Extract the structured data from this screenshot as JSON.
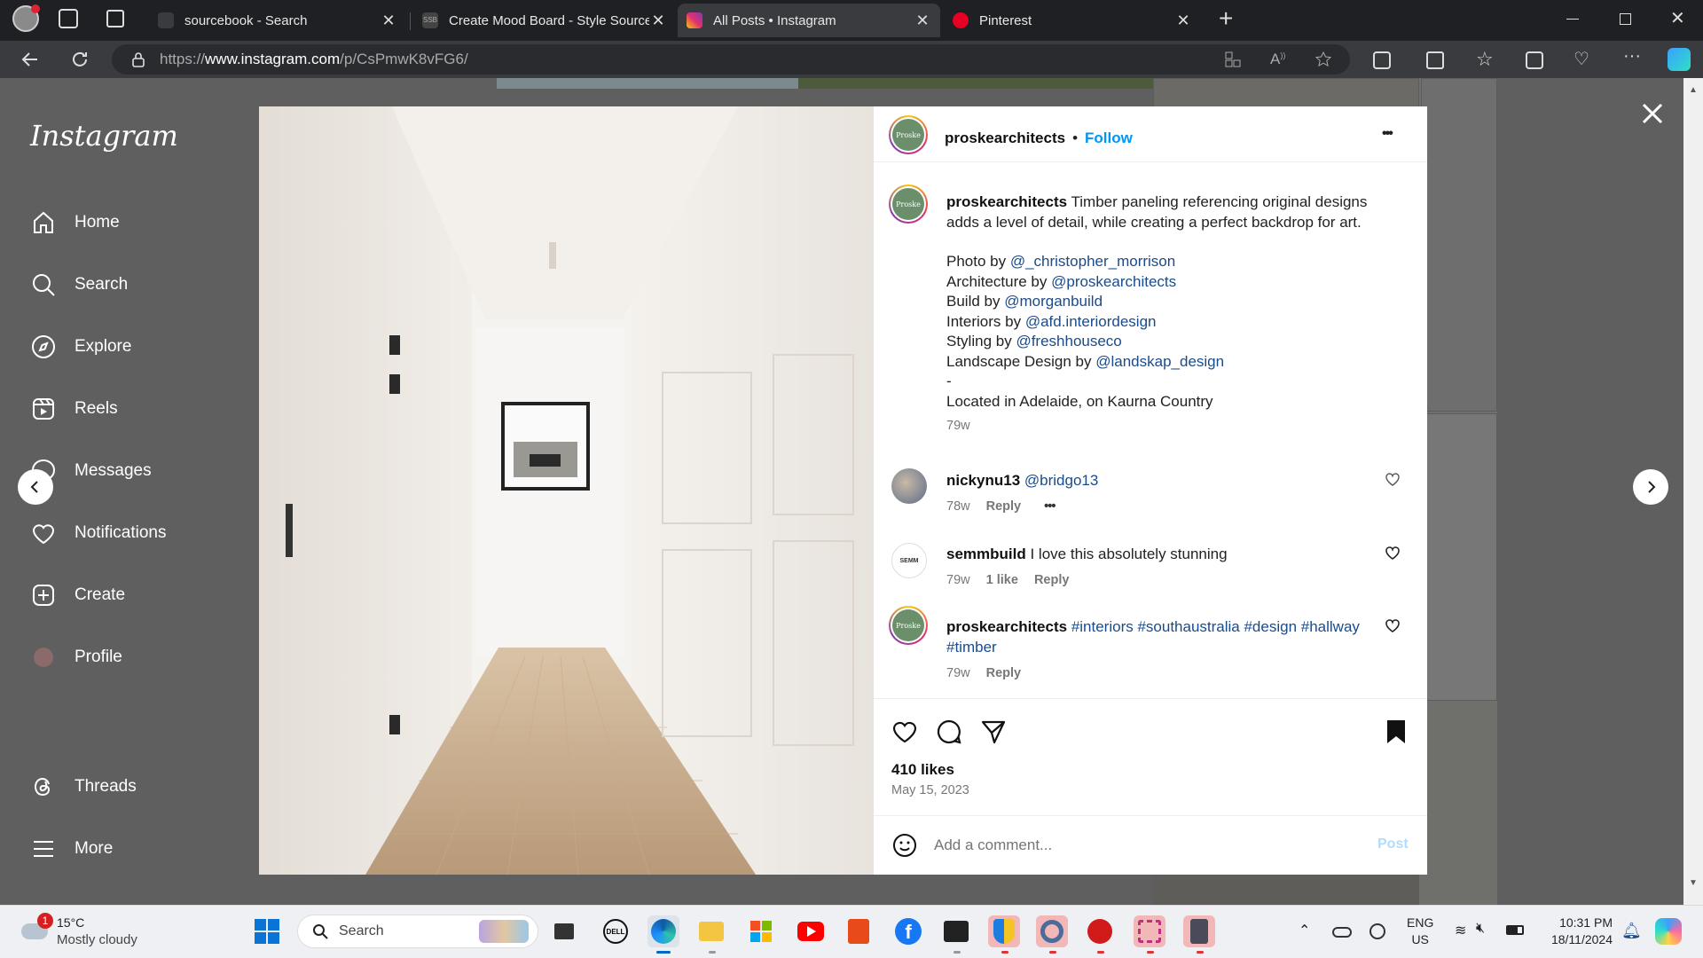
{
  "browser": {
    "tabs": [
      {
        "title": "sourcebook - Search",
        "icon": "globe-icon"
      },
      {
        "title": "Create Mood Board - Style Source",
        "icon": "ssb-icon"
      },
      {
        "title": "All Posts • Instagram",
        "icon": "instagram-icon"
      },
      {
        "title": "Pinterest",
        "icon": "pinterest-icon"
      }
    ],
    "url": "https://www.instagram.com/p/CsPmwK8vFG6/",
    "url_domain": "www.instagram.com",
    "url_prefix": "https://",
    "url_path": "/p/CsPmwK8vFG6/",
    "new_tab": "+"
  },
  "sidebar": {
    "logo": "Instagram",
    "items": [
      {
        "label": "Home",
        "icon": "home-icon"
      },
      {
        "label": "Search",
        "icon": "search-icon"
      },
      {
        "label": "Explore",
        "icon": "compass-icon"
      },
      {
        "label": "Reels",
        "icon": "reels-icon"
      },
      {
        "label": "Messages",
        "icon": "messenger-icon"
      },
      {
        "label": "Notifications",
        "icon": "heart-icon"
      },
      {
        "label": "Create",
        "icon": "plus-square-icon"
      },
      {
        "label": "Profile",
        "icon": "avatar-icon"
      },
      {
        "label": "Threads",
        "icon": "threads-icon"
      },
      {
        "label": "More",
        "icon": "menu-icon"
      }
    ]
  },
  "post": {
    "author": "proskearchitects",
    "avatar_text": "Proske",
    "follow": "Follow",
    "separator": "•",
    "more": "•••",
    "caption": {
      "lead": "Timber paneling referencing original designs adds a level of detail, while creating a perfect backdrop for art.",
      "credits": [
        {
          "prefix": "Photo by ",
          "handle": "@_christopher_morrison"
        },
        {
          "prefix": "Architecture by ",
          "handle": "@proskearchitects"
        },
        {
          "prefix": "Build by ",
          "handle": "@morganbuild"
        },
        {
          "prefix": "Interiors by ",
          "handle": "@afd.interiordesign"
        },
        {
          "prefix": "Styling by ",
          "handle": "@freshhouseco"
        },
        {
          "prefix": "Landscape Design by ",
          "handle": "@landskap_design"
        }
      ],
      "dash": "-",
      "location": "Located in Adelaide, on Kaurna Country",
      "age": "79w"
    },
    "comments": [
      {
        "user": "nickynu13",
        "text": "",
        "mention": "@bridgo13",
        "age": "78w",
        "likes": "",
        "reply": "Reply",
        "more": "•••"
      },
      {
        "user": "semmbuild",
        "text": "I love this absolutely stunning",
        "mention": "",
        "age": "79w",
        "likes": "1 like",
        "reply": "Reply",
        "more": ""
      },
      {
        "user": "proskearchitects",
        "text": "",
        "mention": "#interiors #southaustralia #design #hallway #timber",
        "age": "79w",
        "likes": "",
        "reply": "Reply",
        "more": ""
      }
    ],
    "likes": "410 likes",
    "date": "May 15, 2023",
    "comment_placeholder": "Add a comment...",
    "post_button": "Post"
  },
  "taskbar": {
    "weather_temp": "15°C",
    "weather_desc": "Mostly cloudy",
    "weather_badge": "1",
    "search_label": "Search",
    "lang_top": "ENG",
    "lang_bottom": "US",
    "time": "10:31 PM",
    "date": "18/11/2024",
    "apps": [
      "windows-icon",
      "file-explorer-icon",
      "dell-icon",
      "edge-icon",
      "folder-icon",
      "store-icon",
      "youtube-icon",
      "office-icon",
      "facebook-icon",
      "film-icon",
      "shield-icon",
      "settings-icon",
      "app-red-icon",
      "snipping-icon",
      "calculator-icon"
    ]
  },
  "colors": {
    "link": "#1a4b8c",
    "follow": "#0095f6",
    "post_button_disabled": "#b3dbff",
    "panel_bg": "#ffffff",
    "backdrop": "#5f5f5f"
  }
}
